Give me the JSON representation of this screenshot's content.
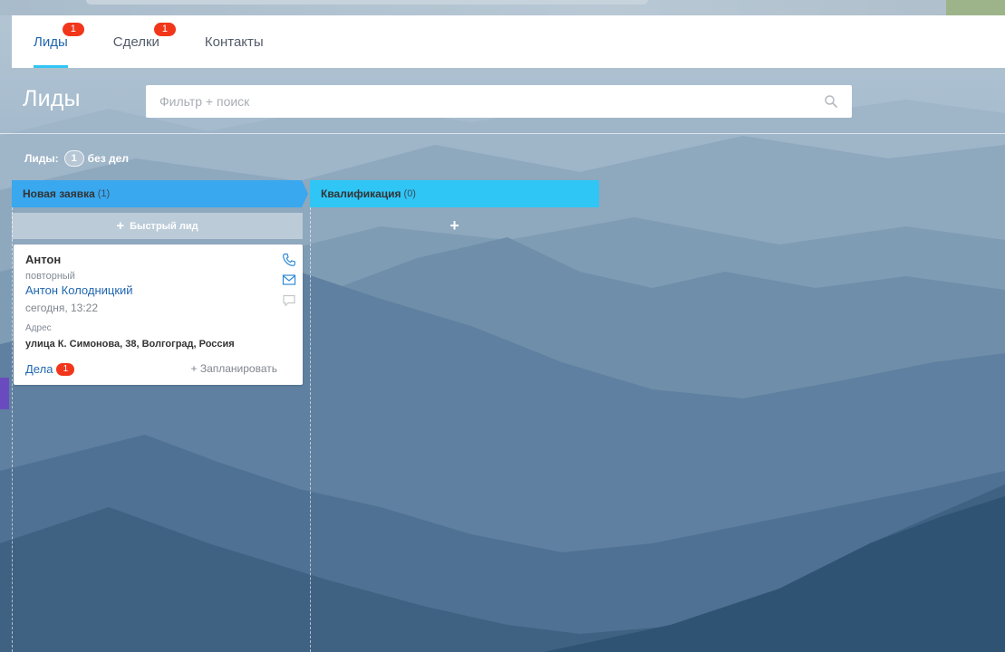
{
  "tabs": [
    {
      "label": "Лиды",
      "badge": "1",
      "active": true
    },
    {
      "label": "Сделки",
      "badge": "1",
      "active": false
    },
    {
      "label": "Контакты",
      "badge": "",
      "active": false
    }
  ],
  "page": {
    "title": "Лиды",
    "filter_placeholder": "Фильтр + поиск"
  },
  "counter": {
    "prefix": "Лиды:",
    "count": "1",
    "suffix": "без дел"
  },
  "stages": [
    {
      "name": "Новая заявка",
      "count": "(1)",
      "color": "#39a8ef"
    },
    {
      "name": "Квалификация",
      "count": "(0)",
      "color": "#2fc6f6"
    }
  ],
  "quick_lead": {
    "plus": "+",
    "label": "Быстрый лид"
  },
  "column2_add": "+",
  "card": {
    "title": "Антон",
    "status": "повторный",
    "contact": "Антон Колодницкий",
    "date": "сегодня, 13:22",
    "address_label": "Адрес",
    "address": "улица К. Симонова, 38, Волгоград, Россия",
    "deals_label": "Дела",
    "deals_badge": "1",
    "plan_label": "+ Запланировать"
  },
  "colors": {
    "accent_blue": "#2067b0",
    "stage_new": "#39a8ef",
    "stage_qual": "#2fc6f6",
    "badge_red": "#f1361b"
  }
}
